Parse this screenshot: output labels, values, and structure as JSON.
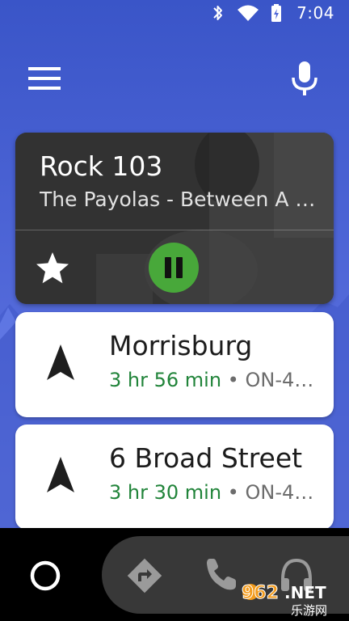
{
  "status_bar": {
    "time": "7:04",
    "icons": [
      "bluetooth-icon",
      "wifi-icon",
      "battery-icon"
    ]
  },
  "header": {
    "menu_icon": "menu-icon",
    "mic_icon": "microphone-icon"
  },
  "media": {
    "station": "Rock 103",
    "now_playing": "The Payolas - Between A …",
    "favorite_icon": "star-icon",
    "playback_icon": "pause-icon",
    "colors": {
      "play_button": "#48a83a"
    }
  },
  "navigation_suggestions": [
    {
      "destination": "Morrisburg",
      "eta": "3 hr 56 min",
      "separator": "•",
      "route": "ON-4…",
      "icon": "navigation-arrow-icon"
    },
    {
      "destination": "6 Broad Street",
      "eta": "3 hr 30 min",
      "separator": "•",
      "route": "ON-4…",
      "icon": "navigation-arrow-icon"
    }
  ],
  "bottom_nav": {
    "items": [
      "home-circle-icon",
      "directions-icon",
      "phone-icon",
      "headphones-icon"
    ]
  },
  "watermark": {
    "text": "962.NET",
    "subtext": "乐游网"
  },
  "colors": {
    "background": "#5067d8",
    "eta_green": "#21843a",
    "card": "#ffffff",
    "dock": "#383838"
  }
}
